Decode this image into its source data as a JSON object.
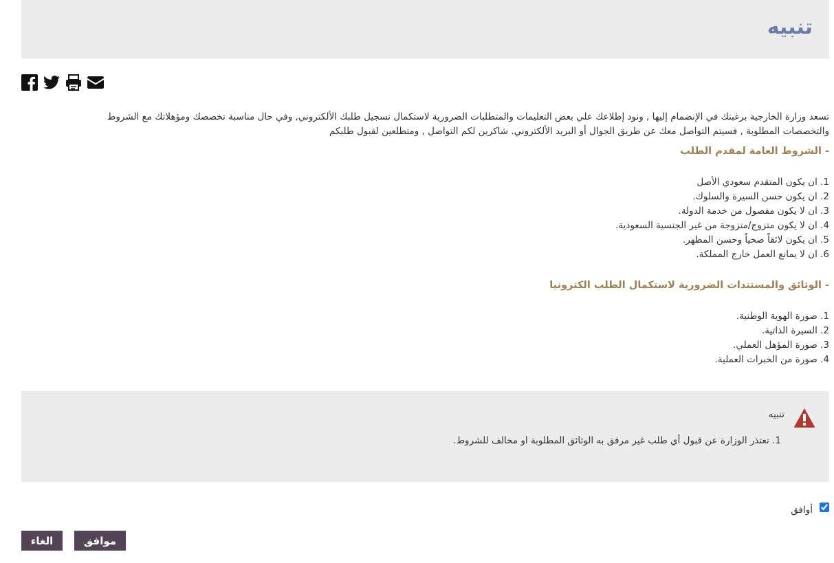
{
  "header": {
    "title": "تنبيه"
  },
  "share": {
    "icons": [
      "facebook-icon",
      "twitter-icon",
      "print-icon",
      "email-icon"
    ]
  },
  "intro": {
    "line1": "تسعد وزارة الخارجية برغبتك في الإنضمام إليها , ونود إطلاعك علي بعض التعليمات والمتطلبات الضرورية لاستكمال تسجيل طلبك الألكتروني, وفي حال مناسبة تخصصك ومؤهلاتك مع الشروط",
    "line2": "والتخصصات المطلوبة , فسيتم التواصل معك عن طريق الجوال أو البريد الألكتروني. شاكرين لكم التواصل , ومتطلعين لقبول طلبكم"
  },
  "conditions": {
    "heading": "- الشروط العامة لمقدم الطلب",
    "items": [
      "1. ان يكون المتقدم سعودي الأصل",
      "2. ان يكون حسن السيرة والسلوك.",
      "3. ان لا يكون مفصول من خدمة الدولة.",
      "4. ان لا يكون متزوج/متزوجة من غير الجنسية السعودية.",
      "5. ان يكون لائقاً صحياً وحسن المظهر.",
      "6. ان لا يمانع العمل خارج المملكة."
    ]
  },
  "documents": {
    "heading": "- الوثائق والمستندات الضرورية لاستكمال الطلب الكترونيا",
    "items": [
      "1. صورة الهوية الوطنية.",
      "2. السيرة الذاتية.",
      "3. صورة المؤهل العملي.",
      "4. صورة من الخبرات العملية."
    ]
  },
  "warning": {
    "title": "تنبيه",
    "text": "1. تعتذر الوزارة عن قبول أي طلب غير مرفق به الوثائق المطلوبة او مخالف للشروط.",
    "icon": "warning-triangle-icon",
    "icon_color": "#b03a2e"
  },
  "agree": {
    "label": "أوافق",
    "checked": true
  },
  "actions": {
    "cancel_label": "الغاء",
    "ok_label": "موافق"
  },
  "colors": {
    "title": "#6a7ea7",
    "heading": "#a08050",
    "button_bg": "#534556",
    "panel_bg": "#ececec"
  }
}
